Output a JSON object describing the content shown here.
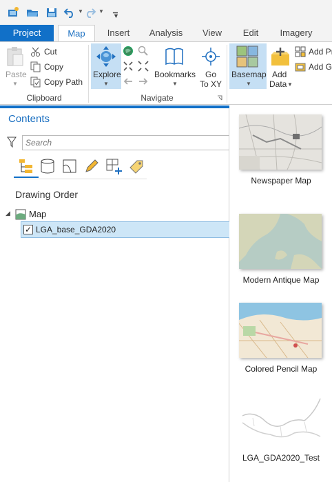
{
  "quick_access": {
    "icons": [
      "new-project-icon",
      "open-folder-icon",
      "save-icon",
      "undo-icon",
      "redo-icon",
      "customize-qat-icon"
    ]
  },
  "tabs": [
    {
      "label": "Project"
    },
    {
      "label": "Map"
    },
    {
      "label": "Insert"
    },
    {
      "label": "Analysis"
    },
    {
      "label": "View"
    },
    {
      "label": "Edit"
    },
    {
      "label": "Imagery"
    }
  ],
  "ribbon": {
    "clipboard": {
      "paste": "Paste",
      "cut": "Cut",
      "copy": "Copy",
      "copy_path": "Copy Path",
      "group_label": "Clipboard"
    },
    "navigate": {
      "explore": "Explore",
      "bookmarks": "Bookmarks",
      "go_to_xy_line1": "Go",
      "go_to_xy_line2": "To XY",
      "group_label": "Navigate"
    },
    "layer": {
      "basemap": "Basemap",
      "add_data_line1": "Add",
      "add_data_line2": "Data",
      "add_preset": "Add Pr",
      "add_graphics": "Add G"
    }
  },
  "contents": {
    "title": "Contents",
    "search_placeholder": "Search",
    "drawing_order": "Drawing Order",
    "map_label": "Map",
    "layer_label": "LGA_base_GDA2020",
    "layer_checked": true
  },
  "gallery": {
    "items": [
      {
        "label": "Newspaper Map"
      },
      {
        "label": "Modern Antique Map"
      },
      {
        "label": "Colored Pencil Map"
      },
      {
        "label": "LGA_GDA2020_Test"
      }
    ]
  },
  "colors": {
    "accent": "#1170c8",
    "selected_row": "#cde6f7",
    "selected_button": "#c5dff4"
  }
}
